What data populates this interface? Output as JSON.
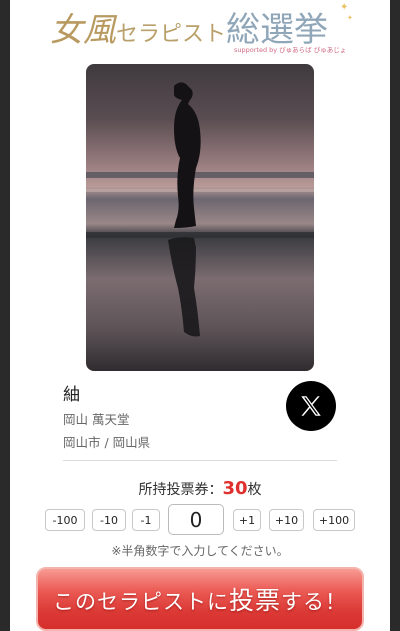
{
  "logo": {
    "title_part1": "女風",
    "title_part2": "セラピスト",
    "title_part3": "総選挙",
    "tagline": "supported by ぴゅあらば ぴゅあじょ"
  },
  "therapist": {
    "name": "紬",
    "shop": "岡山 萬天堂",
    "location": "岡山市 / 岡山県"
  },
  "social": {
    "icon": "x-logo-icon"
  },
  "tickets": {
    "label": "所持投票券：",
    "count": "30",
    "unit": "枚"
  },
  "stepper": {
    "minus100": "-100",
    "minus10": "-10",
    "minus1": "-1",
    "value": "0",
    "plus1": "+1",
    "plus10": "+10",
    "plus100": "+100"
  },
  "note": "※半角数字で入力してください。",
  "vote_button": {
    "label_prefix": "このセラピストに",
    "label_emph": "投票",
    "label_suffix": "する！"
  },
  "colors": {
    "accent_red": "#e0302e",
    "button_red": "#dc3a36",
    "logo_gold": "#c7a86b",
    "logo_blue": "#8fa6b8"
  }
}
